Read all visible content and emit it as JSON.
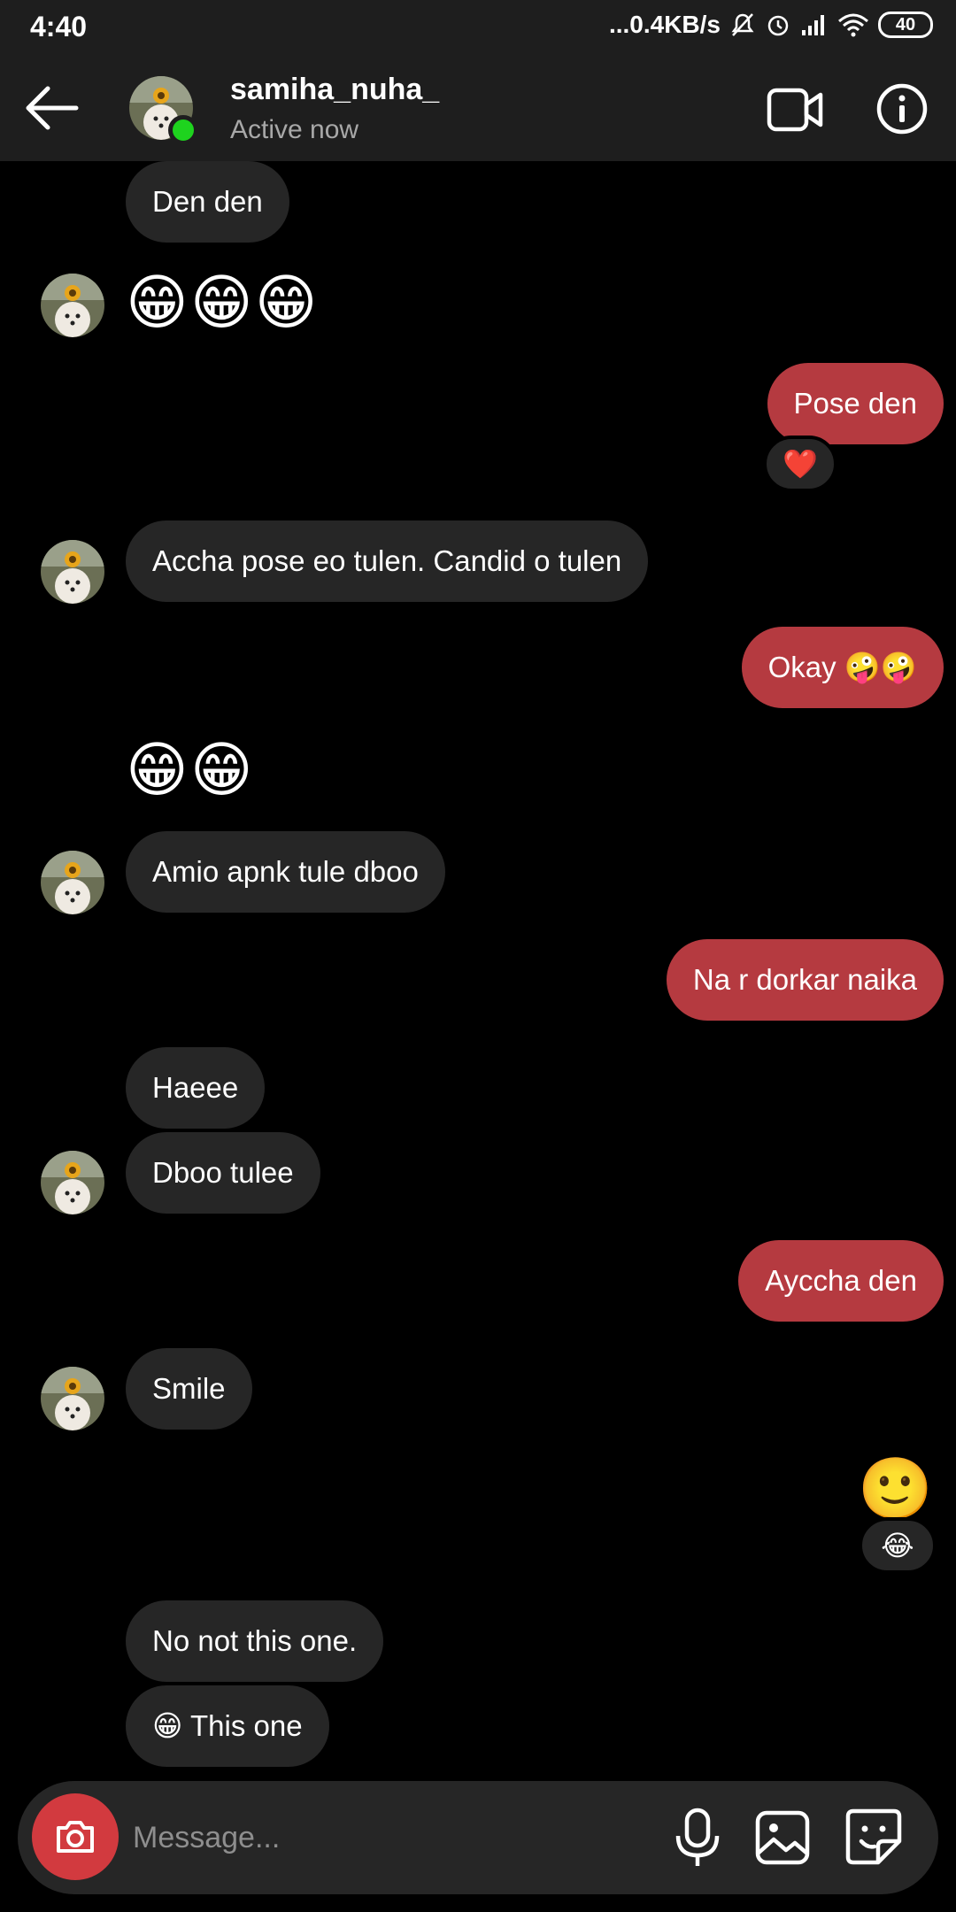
{
  "status_bar": {
    "time": "4:40",
    "network_speed": "...0.4KB/s",
    "battery": "40"
  },
  "header": {
    "username": "samiha_nuha_",
    "status": "Active now"
  },
  "messages": [
    {
      "side": "received",
      "type": "text",
      "text": "Den den"
    },
    {
      "side": "received",
      "type": "emoji",
      "text": "😁😁😁"
    },
    {
      "side": "sent",
      "type": "text",
      "text": "Pose den",
      "reaction": "❤️"
    },
    {
      "side": "received",
      "type": "text",
      "text": "Accha pose eo tulen. Candid o tulen"
    },
    {
      "side": "sent",
      "type": "text",
      "text": "Okay 🤪🤪"
    },
    {
      "side": "received",
      "type": "emoji",
      "text": "😁😁"
    },
    {
      "side": "received",
      "type": "text",
      "text": "Amio apnk tule dboo"
    },
    {
      "side": "sent",
      "type": "text",
      "text": "Na r dorkar naika"
    },
    {
      "side": "received",
      "type": "text",
      "text": "Haeee"
    },
    {
      "side": "received",
      "type": "text",
      "text": "Dboo tulee"
    },
    {
      "side": "sent",
      "type": "text",
      "text": "Ayccha den"
    },
    {
      "side": "received",
      "type": "text",
      "text": "Smile"
    },
    {
      "side": "sent",
      "type": "emoji",
      "text": "🙂",
      "reaction": "😂"
    },
    {
      "side": "received",
      "type": "text",
      "text": "No not this one."
    },
    {
      "side": "received",
      "type": "text",
      "text": "😁 This one"
    }
  ],
  "composer": {
    "placeholder": "Message..."
  },
  "colors": {
    "sent_bubble": "#b53a40",
    "received_bubble": "#262626",
    "camera_button": "#d23a3f",
    "active_dot": "#1ed31e"
  }
}
